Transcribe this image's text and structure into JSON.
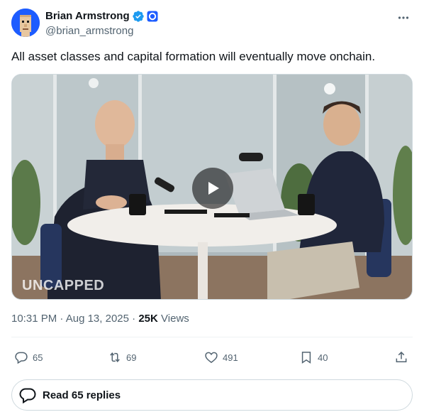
{
  "author": {
    "display_name": "Brian Armstrong",
    "handle": "@brian_armstrong",
    "verified": true,
    "affiliate_badge": "coinbase-badge-icon",
    "avatar": "pixel-punk-avatar"
  },
  "tweet": {
    "text": "All asset classes and capital formation will eventually move onchain."
  },
  "media": {
    "type": "video",
    "watermark": "UNCAPPED",
    "play_icon": "play-icon"
  },
  "meta": {
    "time": "10:31 PM",
    "separator": "·",
    "date": "Aug 13, 2025",
    "views_count": "25K",
    "views_label": "Views"
  },
  "actions": {
    "replies": "65",
    "reposts": "69",
    "likes": "491",
    "bookmarks": "40"
  },
  "read_replies": {
    "label": "Read 65 replies"
  },
  "colors": {
    "verified_blue": "#1d9bf0",
    "secondary_text": "#536471",
    "primary_text": "#0f1419",
    "border": "#cfd9de",
    "brand_blue": "#1d5cff"
  }
}
